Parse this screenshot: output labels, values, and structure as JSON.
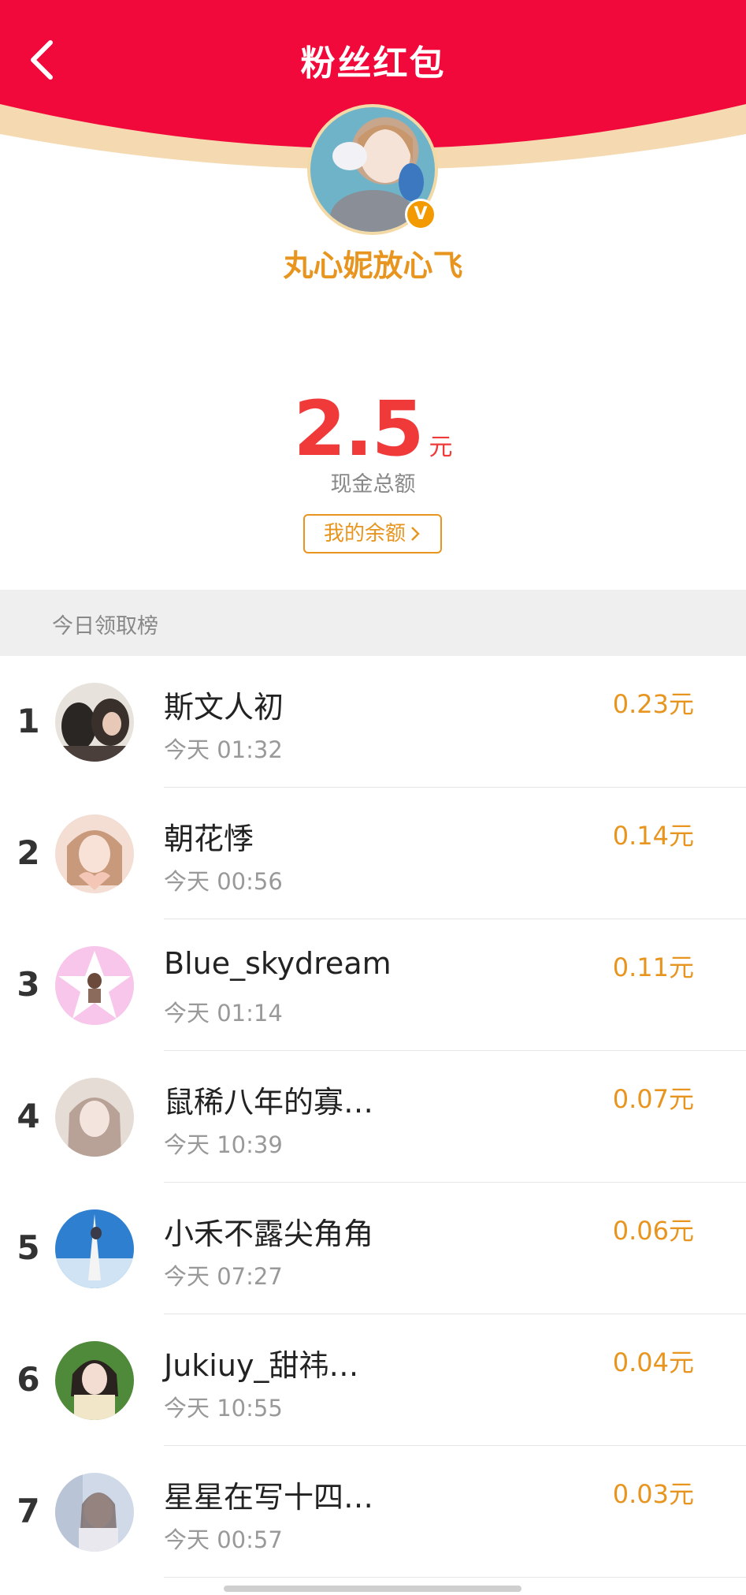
{
  "header": {
    "title": "粉丝红包",
    "bg_color": "#f0093a",
    "curve_color": "#f5d9b0"
  },
  "host": {
    "name": "丸心妮放心飞",
    "verified_badge": "V"
  },
  "summary": {
    "amount": "2.5",
    "unit": "元",
    "label": "现金总额",
    "balance_button": "我的余额"
  },
  "ranking": {
    "title": "今日领取榜",
    "rows": [
      {
        "rank": "1",
        "name": "斯文人初",
        "time": "今天 01:32",
        "amount": "0.23元"
      },
      {
        "rank": "2",
        "name": "朝花悸",
        "time": "今天 00:56",
        "amount": "0.14元"
      },
      {
        "rank": "3",
        "name": "Blue_skydream",
        "time": "今天 01:14",
        "amount": "0.11元"
      },
      {
        "rank": "4",
        "name": "鼠稀八年的寡…",
        "time": "今天 10:39",
        "amount": "0.07元"
      },
      {
        "rank": "5",
        "name": "小禾不露尖角角",
        "time": "今天 07:27",
        "amount": "0.06元"
      },
      {
        "rank": "6",
        "name": "Jukiuy_甜祎…",
        "time": "今天 10:55",
        "amount": "0.04元"
      },
      {
        "rank": "7",
        "name": "星星在写十四…",
        "time": "今天 00:57",
        "amount": "0.03元"
      }
    ]
  }
}
